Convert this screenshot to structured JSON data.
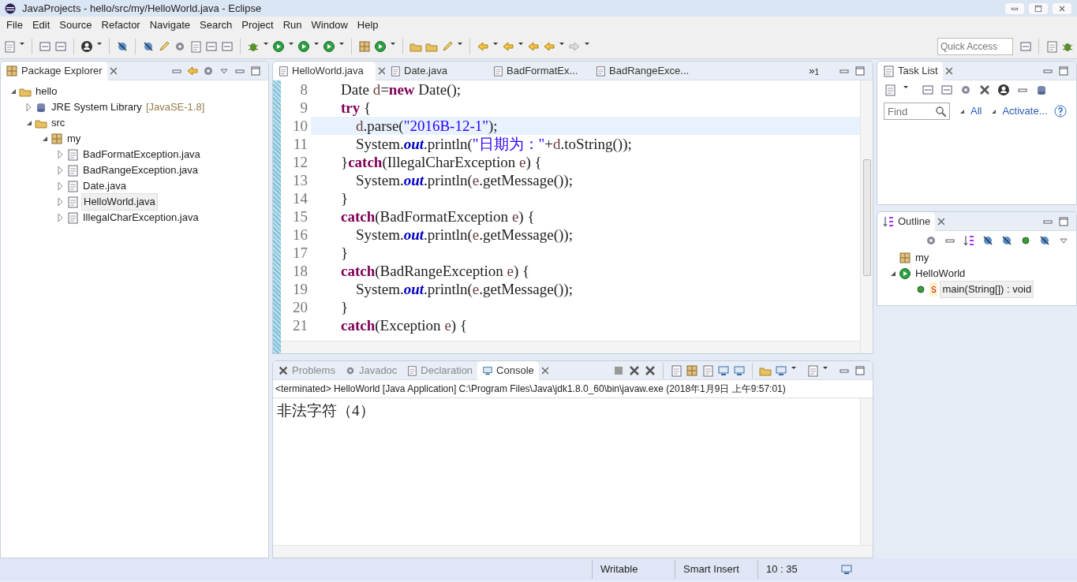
{
  "window": {
    "title": "JavaProjects - hello/src/my/HelloWorld.java - Eclipse"
  },
  "menu": [
    "File",
    "Edit",
    "Source",
    "Refactor",
    "Navigate",
    "Search",
    "Project",
    "Run",
    "Window",
    "Help"
  ],
  "quick_access": {
    "placeholder": "Quick Access"
  },
  "package_explorer": {
    "title": "Package Explorer",
    "tree": [
      {
        "label": "hello",
        "kind": "project",
        "expanded": true,
        "selected": false,
        "children": [
          {
            "label": "JRE System Library",
            "decoration": "[JavaSE-1.8]",
            "kind": "library",
            "expanded": false,
            "selected": false
          },
          {
            "label": "src",
            "kind": "folder",
            "expanded": true,
            "selected": false,
            "children": [
              {
                "label": "my",
                "kind": "package",
                "expanded": true,
                "selected": false,
                "children": [
                  {
                    "label": "BadFormatException.java",
                    "kind": "file",
                    "expanded": false,
                    "selected": false
                  },
                  {
                    "label": "BadRangeException.java",
                    "kind": "file",
                    "expanded": false,
                    "selected": false
                  },
                  {
                    "label": "Date.java",
                    "kind": "file",
                    "expanded": false,
                    "selected": false
                  },
                  {
                    "label": "HelloWorld.java",
                    "kind": "file",
                    "expanded": false,
                    "selected": true
                  },
                  {
                    "label": "IllegalCharException.java",
                    "kind": "file",
                    "expanded": false,
                    "selected": false
                  }
                ]
              }
            ]
          }
        ]
      }
    ]
  },
  "editor": {
    "tabs": [
      {
        "label": "HelloWorld.java",
        "selected": true
      },
      {
        "label": "Date.java",
        "selected": false
      },
      {
        "label": "BadFormatEx...",
        "selected": false
      },
      {
        "label": "BadRangeExce...",
        "selected": false
      }
    ],
    "overflow": "»",
    "overflow_count": "1",
    "lines": [
      {
        "number": "8",
        "current": false,
        "tokens": [
          {
            "kind": "plain",
            "text": "        Date "
          },
          {
            "kind": "variable",
            "text": "d"
          },
          {
            "kind": "plain",
            "text": "="
          },
          {
            "kind": "keyword",
            "text": "new"
          },
          {
            "kind": "plain",
            "text": " Date();"
          }
        ]
      },
      {
        "number": "9",
        "current": false,
        "tokens": [
          {
            "kind": "keyword",
            "text": "        try"
          },
          {
            "kind": "plain",
            "text": " {"
          }
        ]
      },
      {
        "number": "10",
        "current": true,
        "tokens": [
          {
            "kind": "variable",
            "text": "            d"
          },
          {
            "kind": "plain",
            "text": ".parse("
          },
          {
            "kind": "string",
            "text": "\"2016B-12-1\""
          },
          {
            "kind": "plain",
            "text": ");"
          }
        ]
      },
      {
        "number": "11",
        "current": false,
        "tokens": [
          {
            "kind": "plain",
            "text": "            System."
          },
          {
            "kind": "field",
            "text": "out"
          },
          {
            "kind": "plain",
            "text": ".println("
          },
          {
            "kind": "string",
            "text": "\"日期为：\""
          },
          {
            "kind": "plain",
            "text": "+"
          },
          {
            "kind": "variable",
            "text": "d"
          },
          {
            "kind": "plain",
            "text": ".toString());"
          }
        ]
      },
      {
        "number": "12",
        "current": false,
        "tokens": [
          {
            "kind": "plain",
            "text": "        }"
          },
          {
            "kind": "keyword",
            "text": "catch"
          },
          {
            "kind": "plain",
            "text": "(IllegalCharException "
          },
          {
            "kind": "variable",
            "text": "e"
          },
          {
            "kind": "plain",
            "text": ") {"
          }
        ]
      },
      {
        "number": "13",
        "current": false,
        "tokens": [
          {
            "kind": "plain",
            "text": "            System."
          },
          {
            "kind": "field",
            "text": "out"
          },
          {
            "kind": "plain",
            "text": ".println("
          },
          {
            "kind": "variable",
            "text": "e"
          },
          {
            "kind": "plain",
            "text": ".getMessage());"
          }
        ]
      },
      {
        "number": "14",
        "current": false,
        "tokens": [
          {
            "kind": "plain",
            "text": "        }"
          }
        ]
      },
      {
        "number": "15",
        "current": false,
        "tokens": [
          {
            "kind": "keyword",
            "text": "        catch"
          },
          {
            "kind": "plain",
            "text": "(BadFormatException "
          },
          {
            "kind": "variable",
            "text": "e"
          },
          {
            "kind": "plain",
            "text": ") {"
          }
        ]
      },
      {
        "number": "16",
        "current": false,
        "tokens": [
          {
            "kind": "plain",
            "text": "            System."
          },
          {
            "kind": "field",
            "text": "out"
          },
          {
            "kind": "plain",
            "text": ".println("
          },
          {
            "kind": "variable",
            "text": "e"
          },
          {
            "kind": "plain",
            "text": ".getMessage());"
          }
        ]
      },
      {
        "number": "17",
        "current": false,
        "tokens": [
          {
            "kind": "plain",
            "text": "        }"
          }
        ]
      },
      {
        "number": "18",
        "current": false,
        "tokens": [
          {
            "kind": "keyword",
            "text": "        catch"
          },
          {
            "kind": "plain",
            "text": "(BadRangeException "
          },
          {
            "kind": "variable",
            "text": "e"
          },
          {
            "kind": "plain",
            "text": ") {"
          }
        ]
      },
      {
        "number": "19",
        "current": false,
        "tokens": [
          {
            "kind": "plain",
            "text": "            System."
          },
          {
            "kind": "field",
            "text": "out"
          },
          {
            "kind": "plain",
            "text": ".println("
          },
          {
            "kind": "variable",
            "text": "e"
          },
          {
            "kind": "plain",
            "text": ".getMessage());"
          }
        ]
      },
      {
        "number": "20",
        "current": false,
        "tokens": [
          {
            "kind": "plain",
            "text": "        }"
          }
        ]
      },
      {
        "number": "21",
        "current": false,
        "tokens": [
          {
            "kind": "keyword",
            "text": "        catch"
          },
          {
            "kind": "plain",
            "text": "(Exception "
          },
          {
            "kind": "variable",
            "text": "e"
          },
          {
            "kind": "plain",
            "text": ") {"
          }
        ]
      }
    ]
  },
  "task_list": {
    "title": "Task List",
    "find": {
      "placeholder": "Find"
    },
    "filters": [
      "All",
      "Activate..."
    ]
  },
  "outline": {
    "title": "Outline",
    "tree": [
      {
        "label": "my",
        "kind": "package",
        "selected": false
      },
      {
        "label": "HelloWorld",
        "kind": "class",
        "expanded": true,
        "selected": false,
        "children": [
          {
            "label": "main(String[]) : void",
            "modifier": "S",
            "kind": "method",
            "selected": true
          }
        ]
      }
    ]
  },
  "console": {
    "tabs": [
      {
        "label": "Problems",
        "selected": false
      },
      {
        "label": "Javadoc",
        "selected": false
      },
      {
        "label": "Declaration",
        "selected": false
      },
      {
        "label": "Console",
        "selected": true
      }
    ],
    "header": "<terminated> HelloWorld [Java Application] C:\\Program Files\\Java\\jdk1.8.0_60\\bin\\javaw.exe (2018年1月9日 上午9:57:01)",
    "output": [
      "非法字符（4）"
    ]
  },
  "status_bar": [
    "Writable",
    "Smart Insert",
    "10 : 35"
  ]
}
